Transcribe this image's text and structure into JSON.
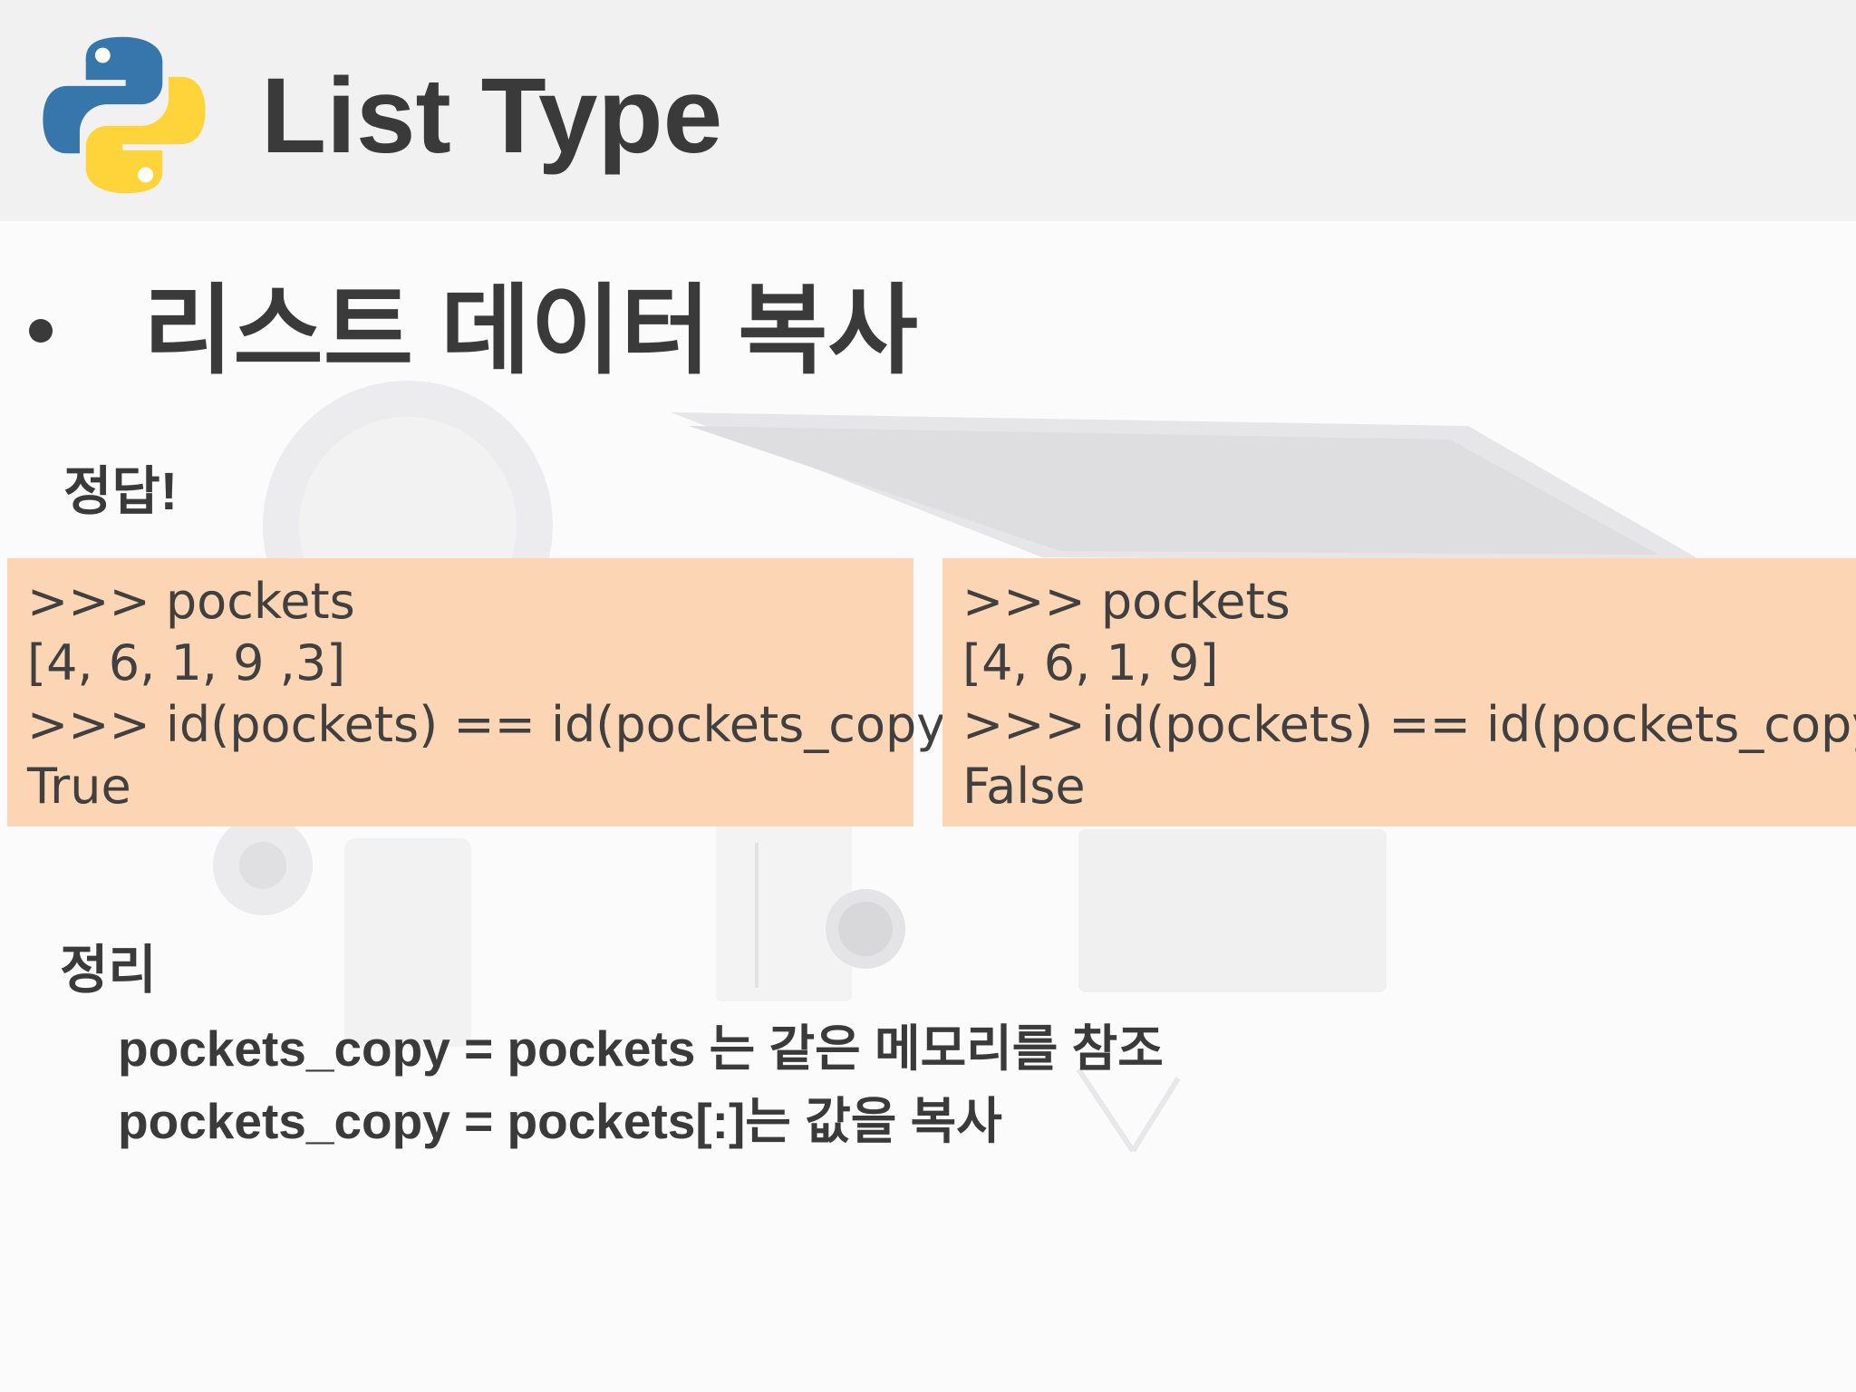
{
  "slide": {
    "title": "List Type",
    "logo_icon": "python-logo-icon"
  },
  "section": {
    "heading": "리스트 데이터 복사"
  },
  "answer": {
    "label": "정답!"
  },
  "code_left": {
    "lines": [
      ">>> pockets",
      "[4, 6, 1, 9 ,3]",
      ">>> id(pockets) == id(pockets_copy)",
      "True"
    ]
  },
  "code_right": {
    "lines": [
      ">>> pockets",
      "[4, 6, 1, 9]",
      ">>> id(pockets) == id(pockets_copy)",
      "False"
    ]
  },
  "summary": {
    "label": "정리",
    "lines": [
      "pockets_copy = pockets 는 같은 메모리를 참조",
      "pockets_copy = pockets[:]는 값을 복사"
    ]
  },
  "colors": {
    "code_box": "#fcd5b4",
    "text": "#3a3a3a",
    "python_blue": "#3776ab",
    "python_yellow": "#ffd43b"
  }
}
